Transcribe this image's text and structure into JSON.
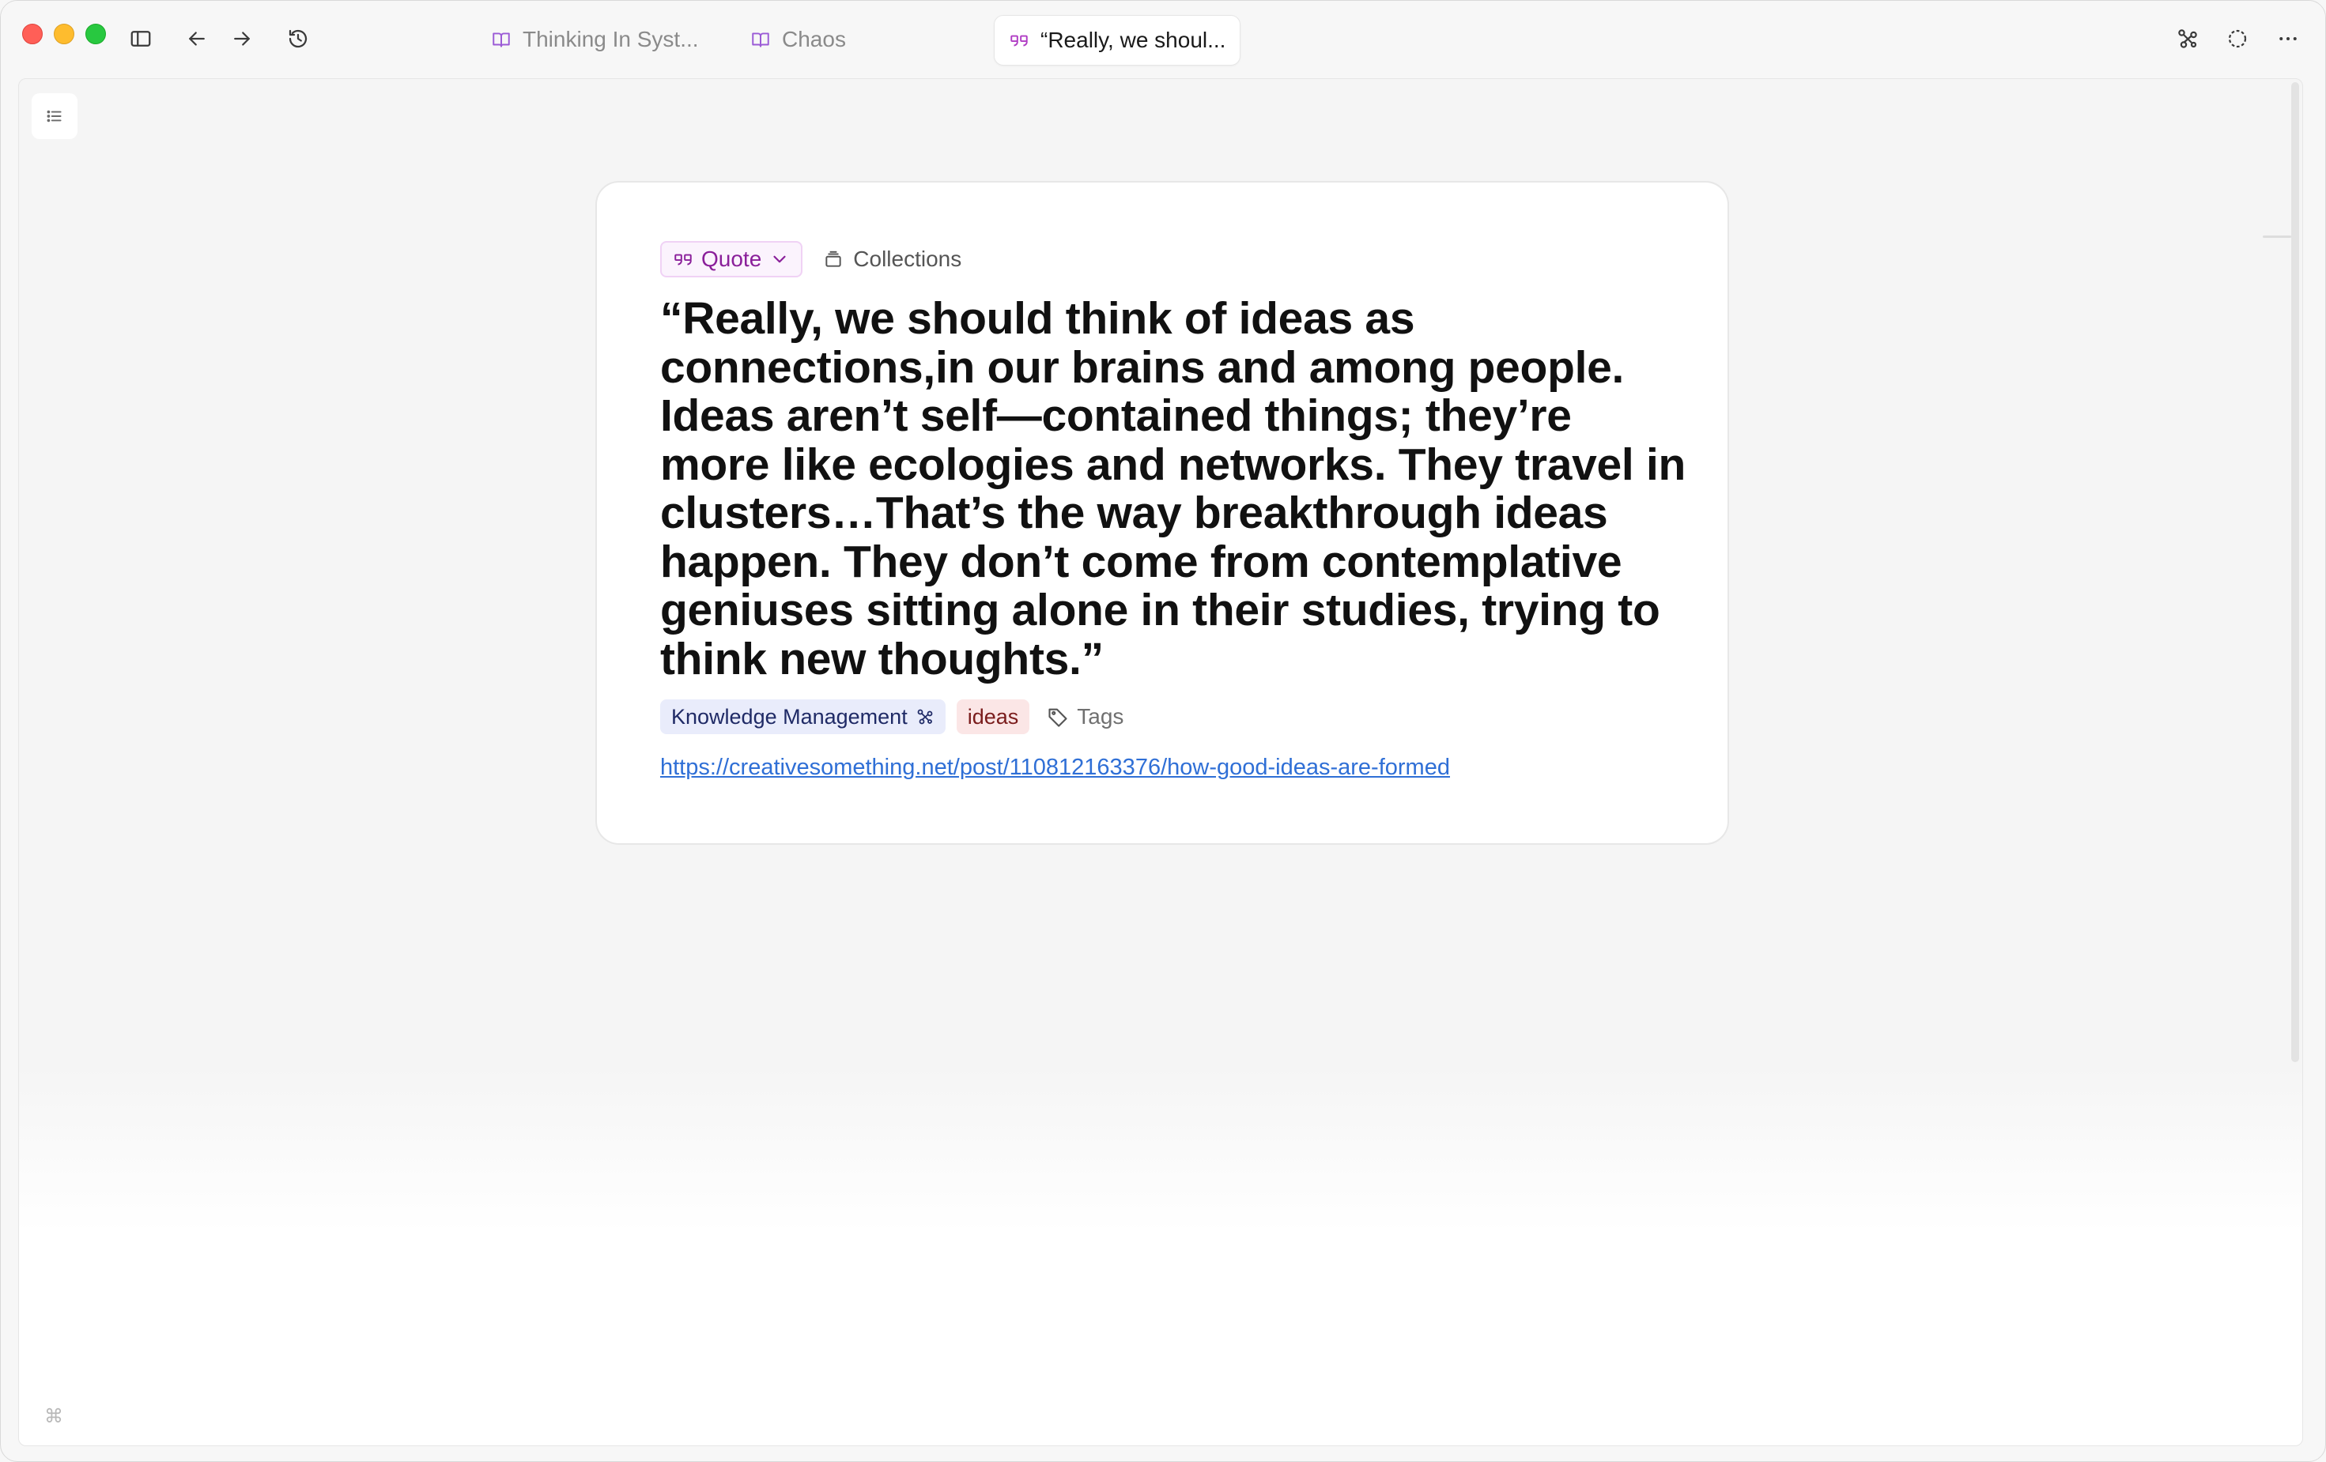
{
  "tabs": [
    {
      "label": "Thinking In Syst...",
      "icon": "book-icon"
    },
    {
      "label": "Chaos",
      "icon": "book-icon"
    },
    {
      "label": "“Really, we shoul...",
      "icon": "quote-icon"
    }
  ],
  "card": {
    "type_label": "Quote",
    "collections_label": "Collections",
    "quote": "“Really, we should think of ideas as connections,in our brains and among people. Ideas aren’t self—contained things; they’re more like ecologies and networks. They travel in clusters…That’s the way breakthrough ideas happen. They don’t come from contemplative geniuses sitting alone in their studies, trying to think new thoughts.”",
    "tags": [
      {
        "label": "Knowledge Management",
        "icon": "graph-icon"
      },
      {
        "label": "ideas"
      }
    ],
    "add_tags_label": "Tags",
    "source_url": "https://creativesomething.net/post/110812163376/how-good-ideas-are-formed"
  },
  "colors": {
    "quote_accent": "#8a1f9a",
    "link": "#2f6fd6",
    "tag_km_bg": "#e9ecfb",
    "tag_ideas_bg": "#fbe6e6"
  }
}
